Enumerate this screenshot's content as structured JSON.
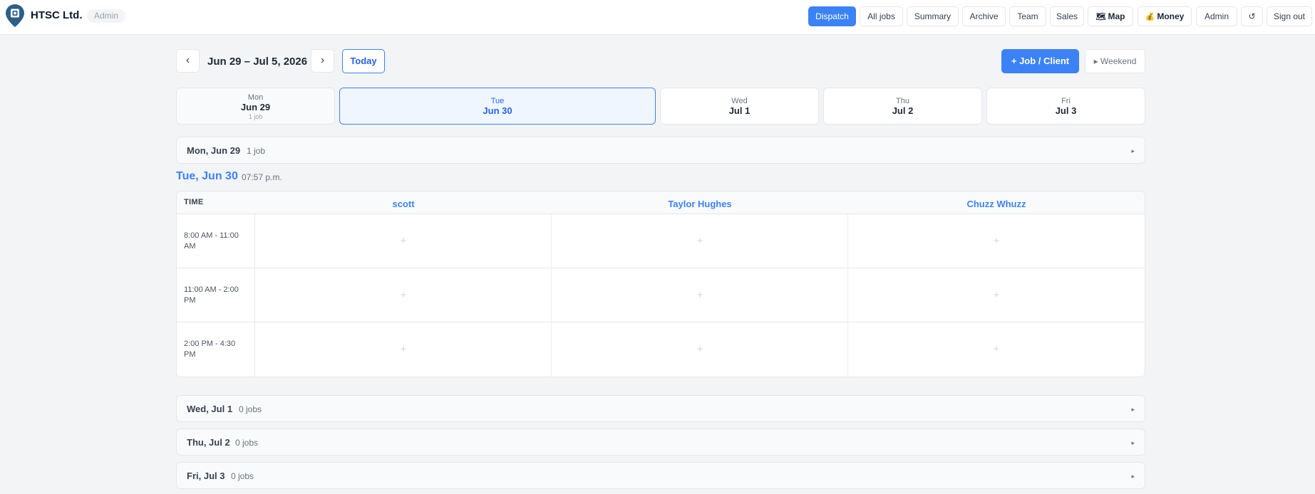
{
  "header": {
    "brand": "HTSC Ltd.",
    "role": "Admin",
    "nav": [
      {
        "label": "Dispatch",
        "active": true
      },
      {
        "label": "All jobs"
      },
      {
        "label": "Summary"
      },
      {
        "label": "Archive"
      },
      {
        "label": "Team"
      },
      {
        "label": "Sales"
      },
      {
        "label": "Map",
        "icon": "map-icon"
      },
      {
        "label": "Money",
        "icon": "money-bag-icon"
      },
      {
        "label": "Admin"
      },
      {
        "label": "↺",
        "icon": "refresh-icon"
      },
      {
        "label": "Sign out"
      }
    ]
  },
  "toolbar": {
    "prev": "‹",
    "next": "›",
    "range": "Jun 29 – Jul 5, 2026",
    "today": "Today",
    "add": "+ Job / Client",
    "weekend": "▸ Weekend"
  },
  "days": [
    {
      "dow": "Mon",
      "date": "Jun 29",
      "count": "1 job"
    },
    {
      "dow": "Tue",
      "date": "Jun 30"
    },
    {
      "dow": "Wed",
      "date": "Jul 1"
    },
    {
      "dow": "Thu",
      "date": "Jul 2"
    },
    {
      "dow": "Fri",
      "date": "Jul 3"
    }
  ],
  "day_rows": [
    {
      "title": "Mon, Jun 29",
      "count": "1 job",
      "caret": "▸"
    },
    {
      "title": "Wed, Jul 1",
      "count": "0 jobs",
      "caret": "▸"
    },
    {
      "title": "Thu, Jul 2",
      "count": "0 jobs",
      "caret": "▸"
    },
    {
      "title": "Fri, Jul 3",
      "count": "0 jobs",
      "caret": "▸"
    }
  ],
  "selected_day": {
    "heading": "Tue, Jun 30",
    "time": "07:57 p.m."
  },
  "schedule": {
    "time_header": "TIME",
    "techs": [
      "scott",
      "Taylor Hughes",
      "Chuzz Whuzz"
    ],
    "slots": [
      "8:00 AM - 11:00 AM",
      "11:00 AM - 2:00 PM",
      "2:00 PM - 4:30 PM"
    ],
    "empty_cell": "+"
  },
  "colors": {
    "accent": "#3b82f6",
    "background": "#f3f4f6",
    "selected_day_bg": "#eff6ff",
    "logo": "#2c5f8a"
  }
}
